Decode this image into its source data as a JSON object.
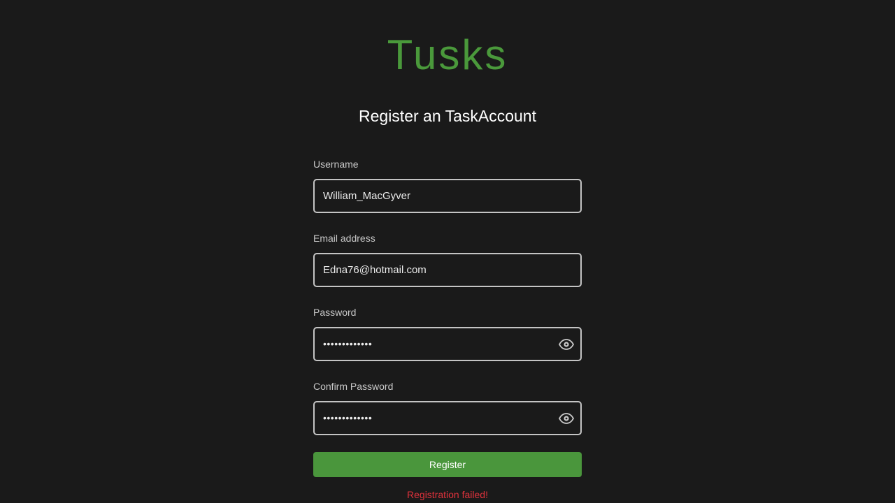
{
  "brand": {
    "title": "Tusks"
  },
  "heading": "Register an TaskAccount",
  "form": {
    "username": {
      "label": "Username",
      "value": "William_MacGyver"
    },
    "email": {
      "label": "Email address",
      "value": "Edna76@hotmail.com"
    },
    "password": {
      "label": "Password",
      "value_masked": "•••••••••••••"
    },
    "confirm_password": {
      "label": "Confirm Password",
      "value_masked": "•••••••••••••"
    },
    "submit_label": "Register",
    "error_message": "Registration failed!"
  },
  "icons": {
    "password_toggle": "eye-icon"
  },
  "colors": {
    "background": "#1a1a1a",
    "brand": "#4a993b",
    "button": "#4a963c",
    "error": "#e0323c",
    "input_border": "#c4c4c4"
  }
}
